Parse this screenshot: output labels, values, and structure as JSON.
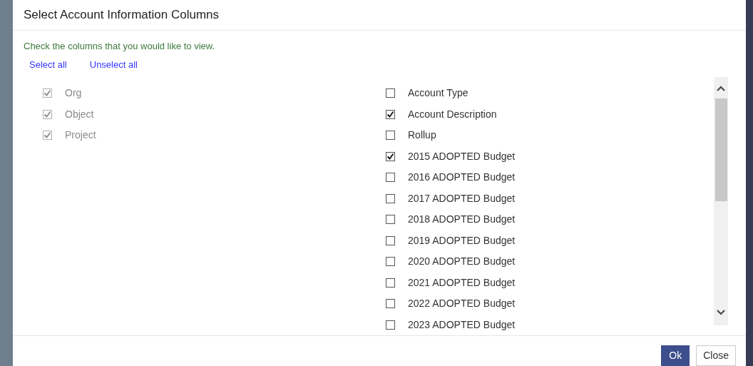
{
  "dialog": {
    "title": "Select Account Information Columns",
    "instruction": "Check the columns that you would like to view.",
    "links": [
      "Select all",
      "Unselect all"
    ],
    "fixed_columns": [
      {
        "label": "Org",
        "checked": true,
        "disabled": true
      },
      {
        "label": "Object",
        "checked": true,
        "disabled": true
      },
      {
        "label": "Project",
        "checked": true,
        "disabled": true
      }
    ],
    "columns": [
      {
        "label": "Account Type",
        "checked": false
      },
      {
        "label": "Account Description",
        "checked": true
      },
      {
        "label": "Rollup",
        "checked": false
      },
      {
        "label": "2015 ADOPTED Budget",
        "checked": true
      },
      {
        "label": "2016 ADOPTED Budget",
        "checked": false
      },
      {
        "label": "2017 ADOPTED Budget",
        "checked": false
      },
      {
        "label": "2018 ADOPTED Budget",
        "checked": false
      },
      {
        "label": "2019 ADOPTED Budget",
        "checked": false
      },
      {
        "label": "2020 ADOPTED Budget",
        "checked": false
      },
      {
        "label": "2021 ADOPTED Budget",
        "checked": false
      },
      {
        "label": "2022 ADOPTED Budget",
        "checked": false
      },
      {
        "label": "2023 ADOPTED Budget",
        "checked": false
      }
    ],
    "buttons": [
      {
        "label": "Ok",
        "kind": "primary"
      },
      {
        "label": "Close",
        "kind": "secondary"
      }
    ]
  }
}
